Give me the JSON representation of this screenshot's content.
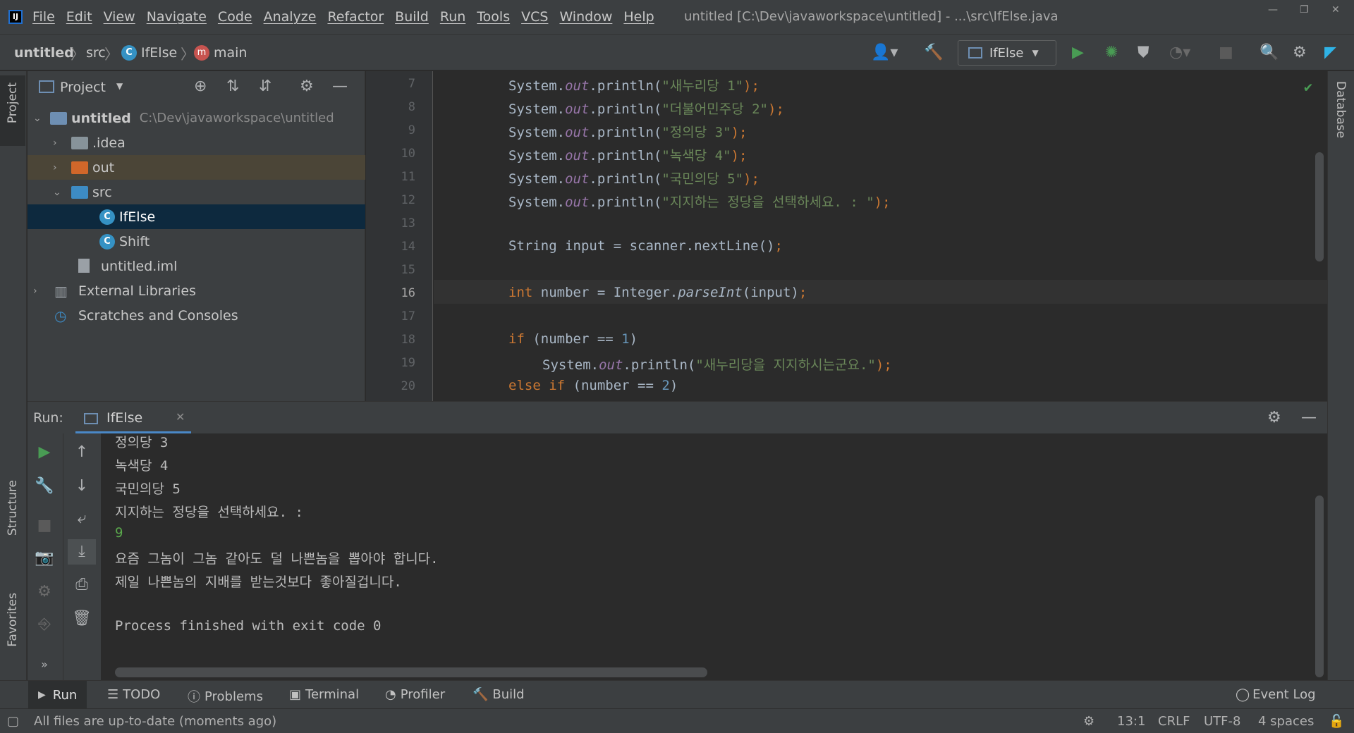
{
  "window": {
    "title": "untitled [C:\\Dev\\javaworkspace\\untitled] - ...\\src\\IfElse.java",
    "app_icon": "intellij-logo-icon"
  },
  "menu": [
    "File",
    "Edit",
    "View",
    "Navigate",
    "Code",
    "Analyze",
    "Refactor",
    "Build",
    "Run",
    "Tools",
    "VCS",
    "Window",
    "Help"
  ],
  "breadcrumb": {
    "project": "untitled",
    "folder": "src",
    "class": "IfElse",
    "method": "main"
  },
  "toolbar": {
    "run_config": "IfElse"
  },
  "tool_strips": {
    "left_top": "Project",
    "left_structure": "Structure",
    "left_favorites": "Favorites",
    "right_database": "Database"
  },
  "project_panel": {
    "title": "Project",
    "tree": [
      {
        "label": "untitled",
        "path": "C:\\Dev\\javaworkspace\\untitled",
        "kind": "module"
      },
      {
        "label": ".idea",
        "kind": "folder"
      },
      {
        "label": "out",
        "kind": "folder-excluded"
      },
      {
        "label": "src",
        "kind": "folder-source"
      },
      {
        "label": "IfElse",
        "kind": "class"
      },
      {
        "label": "Shift",
        "kind": "class"
      },
      {
        "label": "untitled.iml",
        "kind": "file"
      },
      {
        "label": "External Libraries",
        "kind": "libraries"
      },
      {
        "label": "Scratches and Consoles",
        "kind": "scratches"
      }
    ]
  },
  "editor": {
    "line_numbers": [
      "7",
      "8",
      "9",
      "10",
      "11",
      "12",
      "13",
      "14",
      "15",
      "16",
      "17",
      "18",
      "19",
      "20"
    ],
    "lines": {
      "l7": {
        "pre": "System.",
        "field": "out",
        "mid": ".println(",
        "str": "\"새누리당 1\"",
        "end": ");"
      },
      "l8": {
        "pre": "System.",
        "field": "out",
        "mid": ".println(",
        "str": "\"더불어민주당 2\"",
        "end": ");"
      },
      "l9": {
        "pre": "System.",
        "field": "out",
        "mid": ".println(",
        "str": "\"정의당 3\"",
        "end": ");"
      },
      "l10": {
        "pre": "System.",
        "field": "out",
        "mid": ".println(",
        "str": "\"녹색당 4\"",
        "end": ");"
      },
      "l11": {
        "pre": "System.",
        "field": "out",
        "mid": ".println(",
        "str": "\"국민의당 5\"",
        "end": ");"
      },
      "l12": {
        "pre": "System.",
        "field": "out",
        "mid": ".println(",
        "str": "\"지지하는 정당을 선택하세요. : \"",
        "end": ");"
      },
      "l14": {
        "pre": "String input = scanner.nextLine()",
        "end": ";"
      },
      "l16": {
        "kw": "int",
        "pre": " number = Integer.",
        "method": "parseInt",
        "mid": "(input)",
        "end": ";"
      },
      "l18": {
        "kw": "if",
        "pre": " (number == ",
        "num": "1",
        "end": ")"
      },
      "l19": {
        "pre": "System.",
        "field": "out",
        "mid": ".println(",
        "str": "\"새누리당을 지지하시는군요.\"",
        "end": ");"
      },
      "l20": {
        "kw": "else if",
        "pre": " (number == ",
        "num": "2",
        "end": ")"
      }
    }
  },
  "run_panel": {
    "label": "Run:",
    "tab": "IfElse",
    "output": [
      "정의당 3",
      "녹색당 4",
      "국민의당 5",
      "지지하는 정당을 선택하세요. :",
      "9",
      "요즘 그놈이 그놈 같아도 덜 나쁜놈을 뽑아야 합니다.",
      "제일 나쁜놈의 지배를 받는것보다 좋아질겁니다.",
      "",
      "Process finished with exit code 0"
    ]
  },
  "bottom_tabs": [
    "Run",
    "TODO",
    "Problems",
    "Terminal",
    "Profiler",
    "Build"
  ],
  "event_log": "Event Log",
  "status": {
    "message": "All files are up-to-date (moments ago)",
    "position": "13:1",
    "line_sep": "CRLF",
    "encoding": "UTF-8",
    "indent": "4 spaces"
  },
  "colors": {
    "accent_run": "#499c54",
    "selection": "#0d293e",
    "excluded_row": "#4b4537"
  }
}
